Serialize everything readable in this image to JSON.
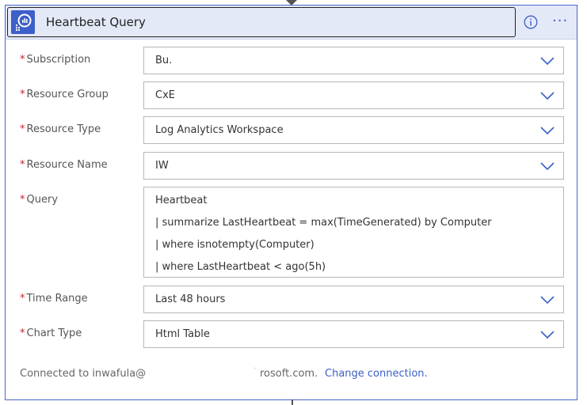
{
  "header": {
    "title": "Heartbeat Query"
  },
  "fields": {
    "subscription": {
      "label": "Subscription",
      "value": "Bu."
    },
    "resource_group": {
      "label": "Resource Group",
      "value": "CxE"
    },
    "resource_type": {
      "label": "Resource Type",
      "value": "Log Analytics Workspace"
    },
    "resource_name": {
      "label": "Resource Name",
      "value": "IW"
    },
    "query": {
      "label": "Query",
      "lines": [
        "Heartbeat",
        "| summarize LastHeartbeat = max(TimeGenerated) by Computer",
        "| where isnotempty(Computer)",
        "| where LastHeartbeat < ago(5h)"
      ]
    },
    "time_range": {
      "label": "Time Range",
      "value": "Last 48 hours"
    },
    "chart_type": {
      "label": "Chart Type",
      "value": "Html Table"
    }
  },
  "required_marker": "*",
  "footer": {
    "connected_prefix": "Connected to inwafula@",
    "tick": "`",
    "connected_suffix": "rosoft.com.",
    "change_link": "Change connection."
  },
  "colors": {
    "accent": "#3b5fc6",
    "header_bg": "#e4e9f8",
    "required": "#c4262e"
  },
  "icons": [
    "app-icon",
    "info-icon",
    "more-icon",
    "chevron-down-icon"
  ]
}
